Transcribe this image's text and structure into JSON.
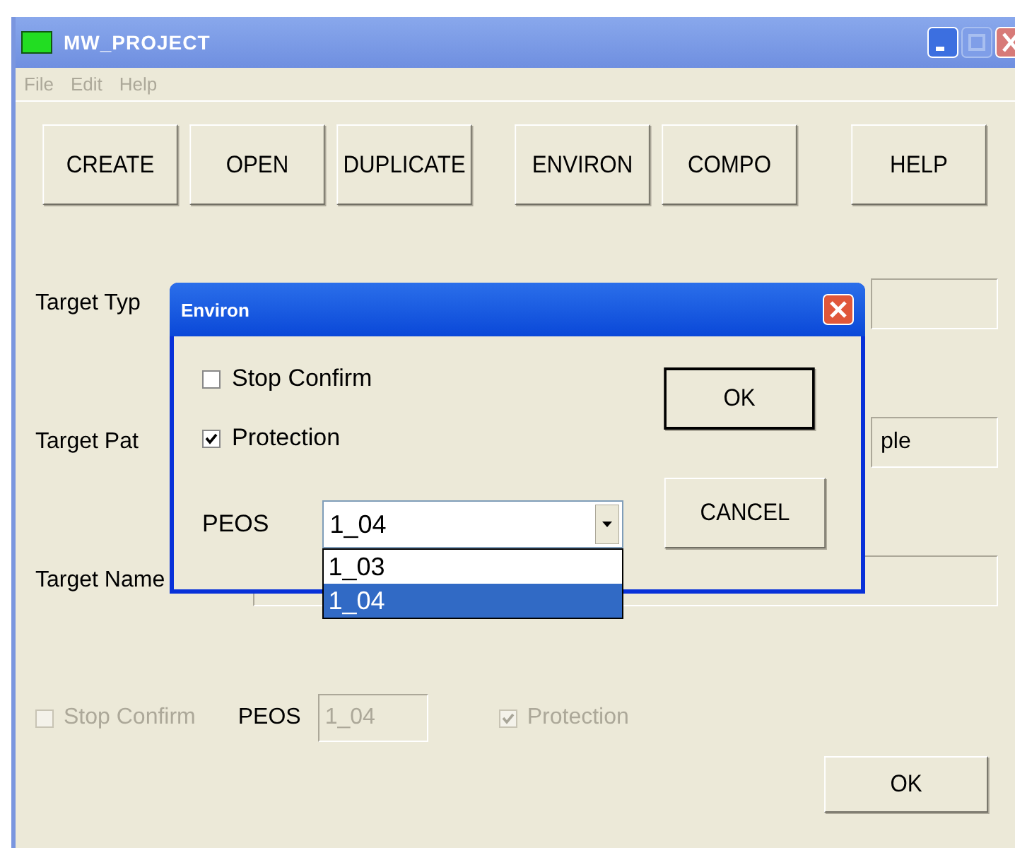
{
  "window": {
    "title": "MW_PROJECT"
  },
  "menu": [
    {
      "label": "File",
      "disabled": true
    },
    {
      "label": "Edit",
      "disabled": true
    },
    {
      "label": "Help",
      "disabled": true
    }
  ],
  "toolbar_groups": [
    [
      "CREATE",
      "OPEN",
      "DUPLICATE"
    ],
    [
      "ENVIRON",
      "COMPO"
    ],
    [
      "HELP"
    ]
  ],
  "fields": [
    {
      "label": "Target Typ"
    },
    {
      "label": "Target Pat",
      "value": "ple"
    },
    {
      "label": "Target Name"
    }
  ],
  "options": [
    {
      "kind": "checkbox",
      "label": "Stop Confirm",
      "checked": false,
      "disabled": true
    },
    {
      "kind": "combo",
      "label": "PEOS",
      "value": "1_04",
      "disabled": true
    },
    {
      "kind": "checkbox",
      "label": "Protection",
      "checked": true,
      "disabled": true
    }
  ],
  "ok_button": "OK",
  "dialog": {
    "title": "Environ",
    "checkboxes": [
      {
        "label": "Stop Confirm",
        "checked": false
      },
      {
        "label": "Protection",
        "checked": true
      }
    ],
    "peos": {
      "label": "PEOS",
      "value": "1_04",
      "options": [
        {
          "label": "1_03",
          "selected": false
        },
        {
          "label": "1_04",
          "selected": true
        }
      ]
    },
    "buttons": [
      {
        "label": "OK",
        "default": true
      },
      {
        "label": "CANCEL",
        "default": false
      }
    ]
  }
}
